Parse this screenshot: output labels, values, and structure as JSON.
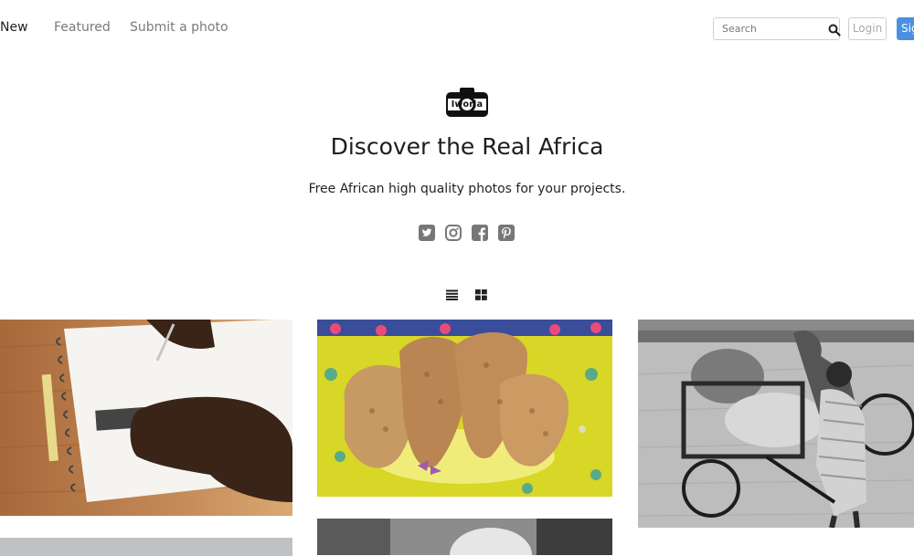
{
  "nav": {
    "links": [
      {
        "label": "New"
      },
      {
        "label": "Featured"
      },
      {
        "label": "Submit a photo"
      }
    ]
  },
  "search": {
    "placeholder": "Search",
    "icon": "search-icon"
  },
  "auth": {
    "login_label": "Login",
    "signup_label": "Sign up"
  },
  "logo": {
    "text": "Iworia",
    "icon": "camera-icon"
  },
  "hero": {
    "title": "Discover the Real Africa",
    "subtitle": "Free African high quality photos for your projects."
  },
  "social": [
    {
      "icon": "twitter-icon"
    },
    {
      "icon": "instagram-icon"
    },
    {
      "icon": "facebook-icon"
    },
    {
      "icon": "pinterest-icon"
    }
  ],
  "view_toggles": [
    {
      "icon": "list-view-icon"
    },
    {
      "icon": "grid-view-icon"
    }
  ],
  "colors": {
    "accent": "#4a90e2",
    "text": "#222222",
    "muted": "#7a7a7a",
    "social": "#777777"
  }
}
